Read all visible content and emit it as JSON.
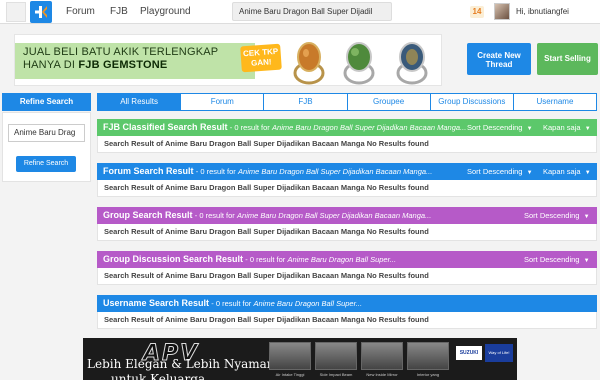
{
  "nav": {
    "links": [
      "Forum",
      "FJB",
      "Playground"
    ],
    "search_value": "Anime Baru Dragon Ball Super Dijadil",
    "notif_count": "14",
    "username": "Hi, ibnutiangfei"
  },
  "banner": {
    "line1": "JUAL BELI BATU AKIK TERLENGKAP",
    "line2_prefix": "HANYA DI ",
    "line2_brand": "FJB GEMSTONE",
    "cta": "CEK TKP GAN!"
  },
  "actions": {
    "create_thread": "Create New Thread",
    "start_selling": "Start Selling"
  },
  "refine": {
    "header": "Refine Search",
    "input_value": "Anime Baru Drag",
    "button": "Refine Search"
  },
  "tabs": [
    "All Results",
    "Forum",
    "FJB",
    "Groupee",
    "Group Discussions",
    "Username"
  ],
  "sections": [
    {
      "title": "FJB Classified Search Result",
      "count": "- 0 result for",
      "query": "Anime Baru Dragon Ball Super Dijadikan Bacaan Manga...",
      "sort": "Sort Descending",
      "time": "Kapan saja",
      "body": "Search Result of Anime Baru Dragon Ball Super Dijadikan Bacaan Manga No Results found",
      "color": "#5cc86b"
    },
    {
      "title": "Forum Search Result",
      "count": "- 0 result for",
      "query": "Anime Baru Dragon Ball Super Dijadikan Bacaan Manga...",
      "sort": "Sort Descending",
      "time": "Kapan saja",
      "body": "Search Result of Anime Baru Dragon Ball Super Dijadikan Bacaan Manga No Results found",
      "color": "#1e88e5"
    },
    {
      "title": "Group Search Result",
      "count": "- 0 result for",
      "query": "Anime Baru Dragon Ball Super Dijadikan Bacaan Manga...",
      "sort": "Sort Descending",
      "time": "",
      "body": "Search Result of Anime Baru Dragon Ball Super Dijadikan Bacaan Manga No Results found",
      "color": "#b65ac8"
    },
    {
      "title": "Group Discussion Search Result",
      "count": "- 0 result for",
      "query": "Anime Baru Dragon Ball Super...",
      "sort": "Sort Descending",
      "time": "",
      "body": "Search Result of Anime Baru Dragon Ball Super Dijadikan Bacaan Manga No Results found",
      "color": "#b65ac8"
    },
    {
      "title": "Username Search Result",
      "count": "- 0 result for",
      "query": "Anime Baru Dragon Ball Super...",
      "sort": "",
      "time": "",
      "body": "Search Result of Anime Baru Dragon Ball Super Dijadikan Bacaan Manga No Results found",
      "color": "#1e88e5"
    }
  ],
  "ad": {
    "logo": "APV",
    "tagline": "Lebih Elegan & Lebih Nyaman",
    "tagline2": "untuk Keluarga",
    "captions": [
      "Air Intake Tinggi",
      "Side Impact Beam",
      "New Inside Mirror",
      "Interior yang"
    ],
    "brand": "SUZUKI",
    "brand2": "Way of Life!"
  }
}
